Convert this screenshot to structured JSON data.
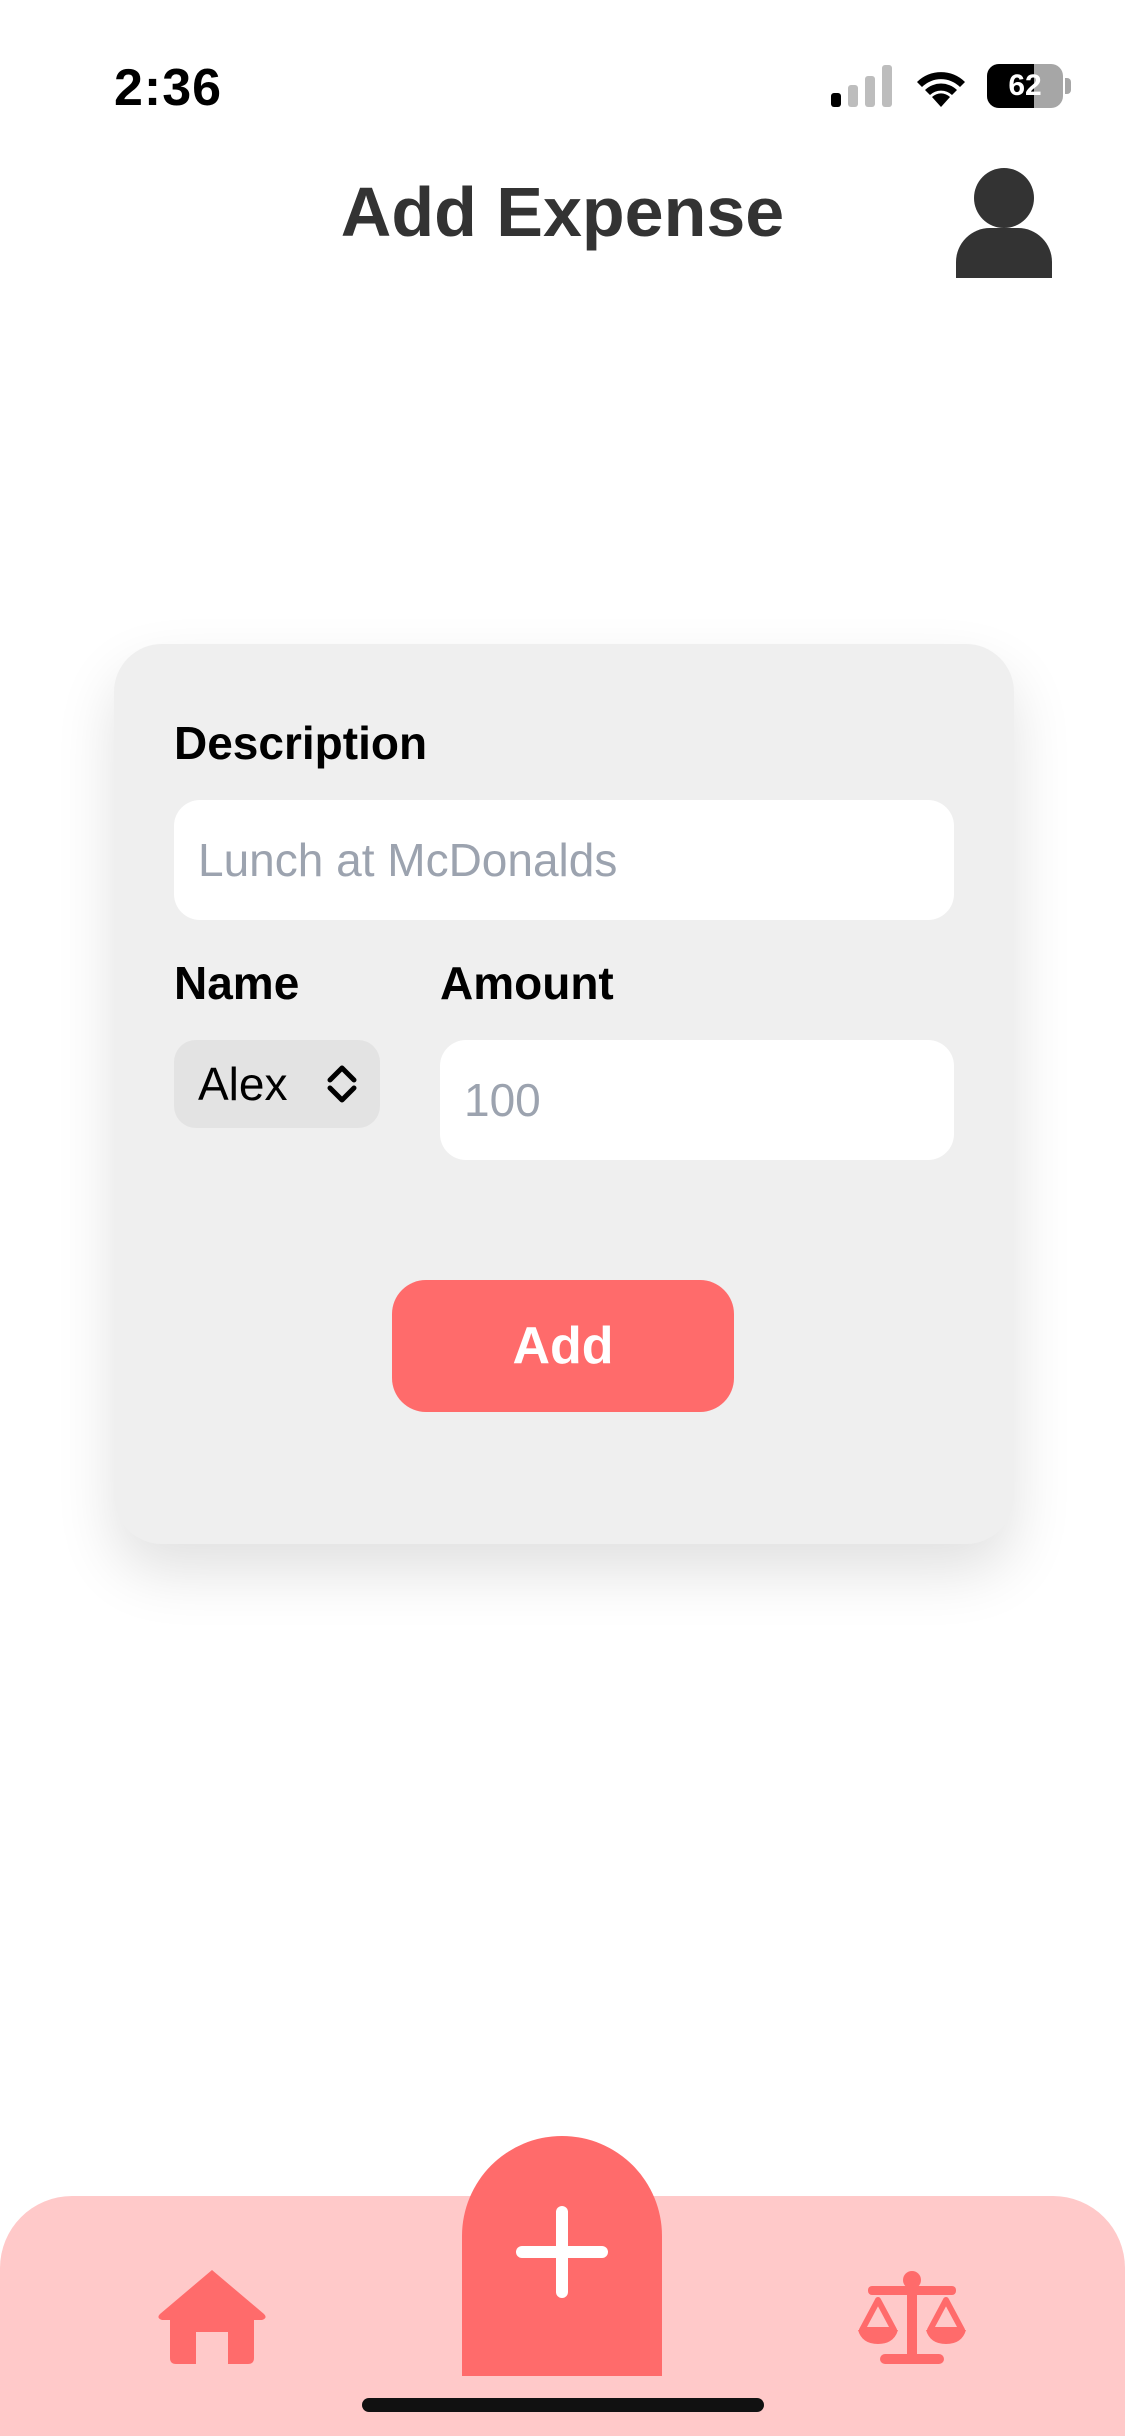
{
  "status_bar": {
    "time": "2:36",
    "battery_level": "62",
    "icons": [
      "signal-icon",
      "wifi-icon",
      "battery-icon"
    ]
  },
  "header": {
    "title": "Add Expense",
    "profile_icon": "person-icon"
  },
  "form": {
    "description_label": "Description",
    "description_placeholder": "Lunch at McDonalds",
    "description_value": "",
    "name_label": "Name",
    "name_selected": "Alex",
    "amount_label": "Amount",
    "amount_placeholder": "100",
    "amount_value": "",
    "submit_label": "Add"
  },
  "bottom_nav": {
    "items": [
      {
        "icon": "home-icon"
      },
      {
        "icon": "plus-icon"
      },
      {
        "icon": "balance-scale-icon"
      }
    ]
  },
  "colors": {
    "accent": "#ff6b6b",
    "nav_background": "#ffc9c9",
    "card_background": "#efefef",
    "title": "#333333"
  }
}
